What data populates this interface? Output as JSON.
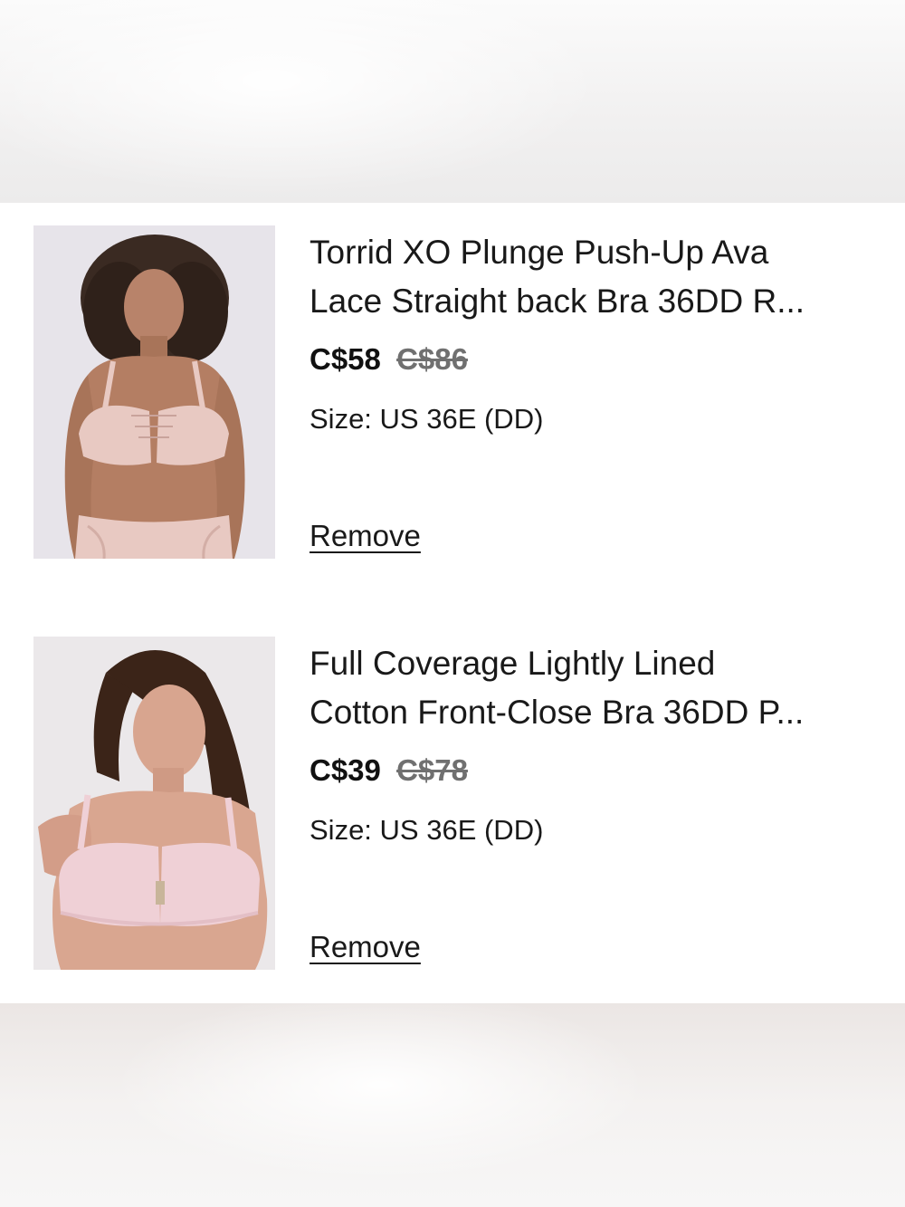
{
  "cart": {
    "items": [
      {
        "title_line1": "Torrid XO Plunge Push-Up Ava",
        "title_line2": "Lace Straight back Bra 36DD R...",
        "price": "C$58",
        "original_price": "C$86",
        "size": "Size: US 36E (DD)",
        "remove_label": "Remove",
        "image": "product-photo-lace-plunge-bra"
      },
      {
        "title_line1": "Full Coverage Lightly Lined",
        "title_line2": "Cotton Front-Close Bra 36DD P...",
        "price": "C$39",
        "original_price": "C$78",
        "size": "Size: US 36E (DD)",
        "remove_label": "Remove",
        "image": "product-photo-front-close-bra"
      }
    ]
  },
  "colors": {
    "text": "#191919",
    "strikethrough_price": "#707070",
    "panel_background": "#ffffff",
    "page_background": "#f2f0ef",
    "product_blush": "#e8c9c2",
    "product_pink": "#efd0d6"
  }
}
